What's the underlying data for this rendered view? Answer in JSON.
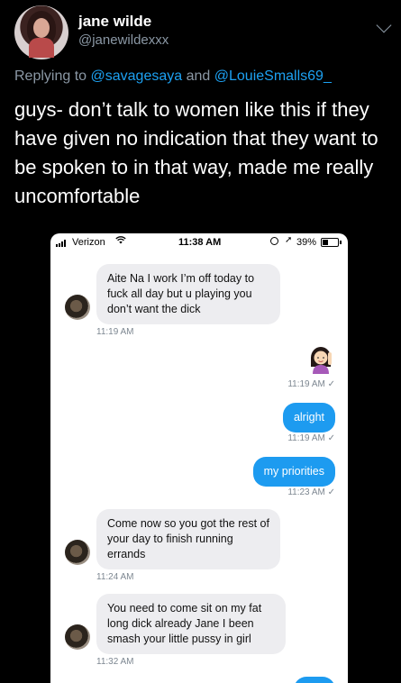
{
  "tweet": {
    "display_name": "jane wilde",
    "handle": "@janewildexxx",
    "replying_to_prefix": "Replying to",
    "mention_1": "@savagesaya",
    "and_word": "and",
    "mention_2": "@LouieSmalls69_",
    "text": "guys- don’t talk to women like this if they have given no indication that they want to be spoken to in that way, made me really uncomfortable"
  },
  "screenshot": {
    "status_bar": {
      "carrier": "Verizon",
      "time": "11:38 AM",
      "battery": "39%",
      "battery_level": 0.39
    },
    "messages": [
      {
        "text": "Aite Na I work I’m off today to fuck all day but u playing you don’t want the dick",
        "time": "11:19 AM"
      },
      {
        "text": "",
        "time": "11:19 AM",
        "check": "✓",
        "emoji": "woman-raising-hand-emoji"
      },
      {
        "text": "alright",
        "time": "11:19 AM",
        "check": "✓"
      },
      {
        "text": "my priorities",
        "time": "11:23 AM",
        "check": "✓"
      },
      {
        "text": "Come now so you got the rest of your day to finish running errands",
        "time": "11:24 AM"
      },
      {
        "text": "You need to come sit on my fat long dick already Jane I been smash your little pussy in girl",
        "time": "11:32 AM"
      }
    ]
  }
}
